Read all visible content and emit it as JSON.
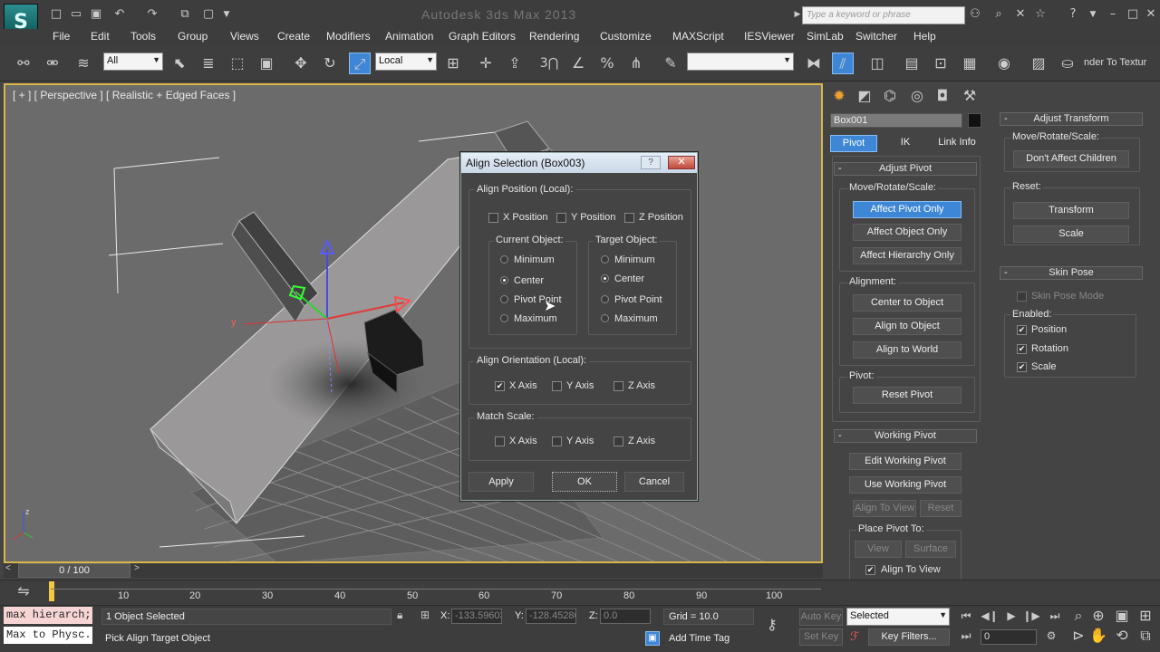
{
  "window": {
    "title": "Autodesk 3ds Max 2013",
    "search_placeholder": "Type a keyword or phrase"
  },
  "menus": [
    "File",
    "Edit",
    "Tools",
    "Group",
    "Views",
    "Create",
    "Modifiers",
    "Animation",
    "Graph Editors",
    "Rendering",
    "Customize",
    "MAXScript",
    "IESViewer",
    "SimLab",
    "Switcher",
    "Help"
  ],
  "toolbar": {
    "selection_filter": "All",
    "reference_coord": "Local",
    "render_to_texture": "nder To Textur",
    "snap_value": "3"
  },
  "viewport": {
    "label": "[ + ] [ Perspective ] [ Realistic + Edged Faces ]",
    "axis_y": "y",
    "axis_z": "z"
  },
  "command_panel": {
    "object_name": "Box001",
    "tabs": [
      "Pivot",
      "IK",
      "Link Info"
    ],
    "adjust_pivot": {
      "header": "Adjust Pivot",
      "move_label": "Move/Rotate/Scale:",
      "buttons": [
        "Affect Pivot Only",
        "Affect Object Only",
        "Affect Hierarchy Only"
      ],
      "alignment_label": "Alignment:",
      "alignment_buttons": [
        "Center to Object",
        "Align to Object",
        "Align to World"
      ],
      "pivot_label": "Pivot:",
      "reset_pivot": "Reset Pivot"
    },
    "working_pivot": {
      "header": "Working Pivot",
      "buttons": [
        "Edit Working Pivot",
        "Use Working Pivot"
      ],
      "align_to_view": "Align To View",
      "reset": "Reset",
      "place_label": "Place Pivot To:",
      "view": "View",
      "surface": "Surface",
      "align_to_view_chk": "Align To View"
    },
    "adjust_transform": {
      "header": "Adjust Transform",
      "move_label": "Move/Rotate/Scale:",
      "dont_affect": "Don't Affect Children",
      "reset_label": "Reset:",
      "transform": "Transform",
      "scale": "Scale"
    },
    "skin_pose": {
      "header": "Skin Pose",
      "mode": "Skin Pose Mode",
      "enabled_label": "Enabled:",
      "position": "Position",
      "rotation": "Rotation",
      "scale": "Scale"
    }
  },
  "dialog": {
    "title": "Align Selection (Box003)",
    "help": "?",
    "align_position_label": "Align Position (Local):",
    "position_checks": [
      "X Position",
      "Y Position",
      "Z Position"
    ],
    "current_object_label": "Current Object:",
    "target_object_label": "Target Object:",
    "options": [
      "Minimum",
      "Center",
      "Pivot Point",
      "Maximum"
    ],
    "current_selected": "Center",
    "target_selected": "Center",
    "orientation_label": "Align Orientation (Local):",
    "axes": [
      "X Axis",
      "Y Axis",
      "Z Axis"
    ],
    "match_scale_label": "Match Scale:",
    "apply": "Apply",
    "ok": "OK",
    "cancel": "Cancel"
  },
  "timeline": {
    "frame": "0 / 100",
    "ticks": [
      "10",
      "20",
      "30",
      "40",
      "50",
      "60",
      "70",
      "80",
      "90",
      "100"
    ]
  },
  "status": {
    "script_line1": "max hierarch;",
    "script_line2": "Max to Physc.",
    "selected": "1 Object Selected",
    "prompt": "Pick Align Target Object",
    "x_label": "X:",
    "x_value": "-133.59603",
    "y_label": "Y:",
    "y_value": "-128.45286",
    "z_label": "Z:",
    "z_value": "0.0",
    "grid": "Grid = 10.0",
    "auto_key": "Auto Key",
    "set_key": "Set Key",
    "key_mode": "Selected",
    "key_filters": "Key Filters...",
    "add_time_tag": "Add Time Tag",
    "frame_value": "0"
  }
}
